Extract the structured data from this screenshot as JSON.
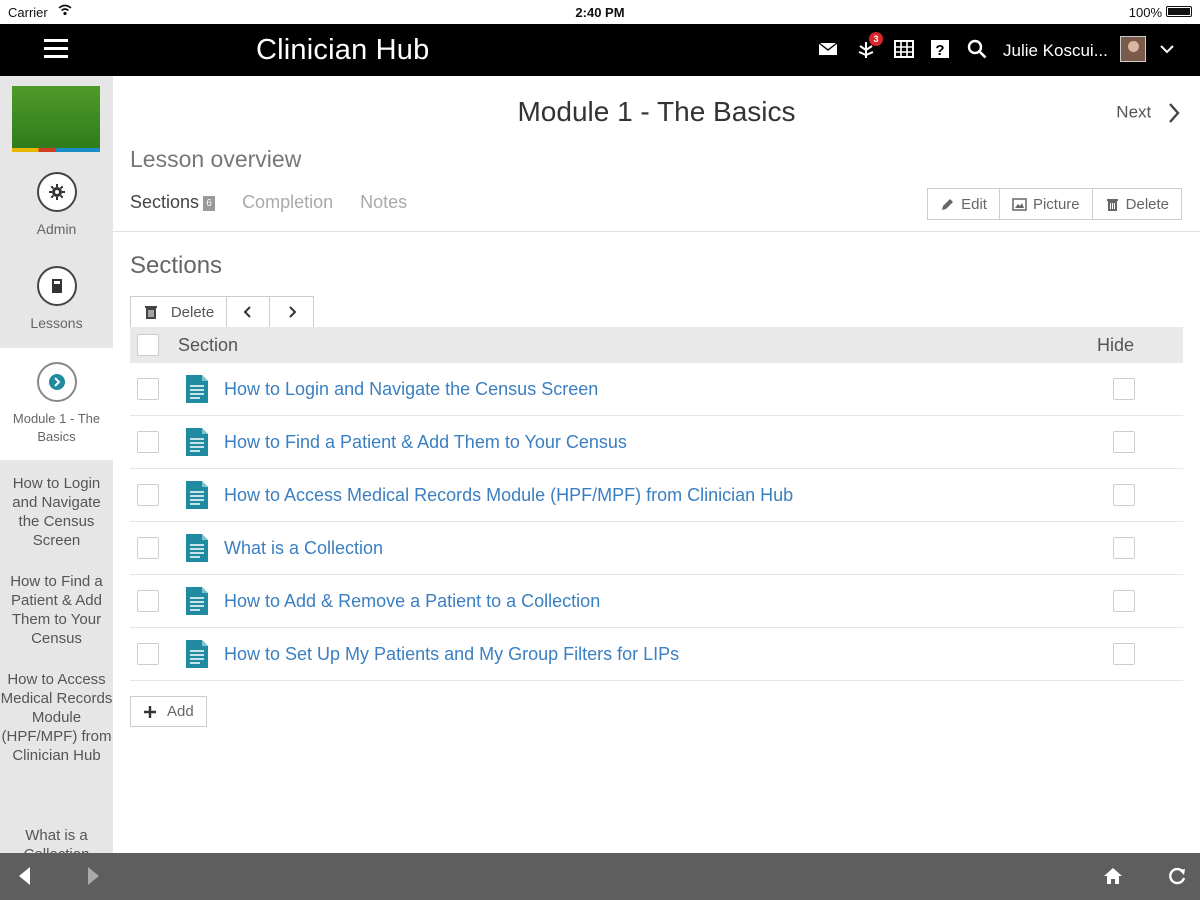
{
  "status_bar": {
    "carrier": "Carrier",
    "time": "2:40 PM",
    "battery": "100%"
  },
  "header": {
    "app_title": "Clinician Hub",
    "notification_count": "3",
    "user_name": "Julie Koscui...",
    "icons": [
      "hamburger-menu-icon",
      "mail-icon",
      "notifications-icon",
      "grid-icon",
      "help-icon",
      "search-icon",
      "chevron-down-icon"
    ],
    "background_color": "#000000"
  },
  "sidebar": {
    "nav": [
      {
        "label": "Admin",
        "icon": "gear-icon"
      },
      {
        "label": "Lessons",
        "icon": "book-icon"
      },
      {
        "label": "Module 1 - The Basics",
        "icon": "arrow-right-circle-icon",
        "active": true
      }
    ],
    "sections": [
      "How to Login and Navigate the Census Screen",
      "How to Find a Patient & Add Them to Your Census",
      "How to Access Medical Records Module (HPF/MPF) from Clinician Hub",
      "What is a Collection"
    ]
  },
  "main": {
    "page_title": "Module 1 - The Basics",
    "next_label": "Next",
    "lesson_overview": "Lesson overview",
    "tabs": [
      {
        "label": "Sections",
        "badge": "6",
        "active": true
      },
      {
        "label": "Completion",
        "active": false
      },
      {
        "label": "Notes",
        "active": false
      }
    ],
    "actions": {
      "edit": "Edit",
      "picture": "Picture",
      "delete": "Delete"
    },
    "sections_heading": "Sections",
    "toolbar": {
      "delete": "Delete"
    },
    "table": {
      "col_section": "Section",
      "col_hide": "Hide",
      "rows": [
        "How to Login and Navigate the Census Screen",
        "How to Find a Patient & Add Them to Your Census",
        "How to Access Medical Records Module (HPF/MPF) from Clinician Hub",
        "What is a Collection",
        "How to Add & Remove a Patient to a Collection",
        "How to Set Up My Patients and My Group Filters for LIPs"
      ]
    },
    "add_label": "Add",
    "link_color": "#3a7fc1",
    "doc_icon_color": "#1f8aa0"
  },
  "bottom_bar": {
    "icons": [
      "back-arrow-icon",
      "forward-arrow-icon",
      "home-icon",
      "refresh-icon"
    ],
    "background_color": "#5e5e5e"
  }
}
